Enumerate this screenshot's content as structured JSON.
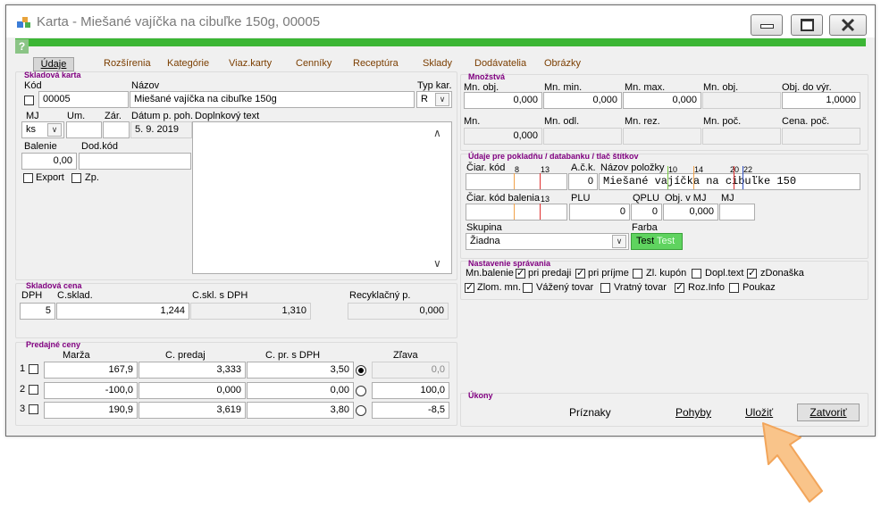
{
  "window": {
    "title": "Karta - Miešané vajíčka na cibuľke 150g, 00005"
  },
  "help": "?",
  "tabs": [
    "Údaje",
    "Rozšírenia",
    "Kategórie",
    "Viaz.karty",
    "Cenníky",
    "Receptúra",
    "Sklady",
    "Dodávatelia",
    "Obrázky"
  ],
  "skladova_karta": {
    "title": "Skladová karta",
    "kod_label": "Kód",
    "kod": "00005",
    "nazov_label": "Názov",
    "nazov": "Miešané vajíčka na cibuľke 150g",
    "typ_label": "Typ kar.",
    "typ": "R",
    "mj_label": "MJ",
    "mj": "ks",
    "um_label": "Um.",
    "zar_label": "Zár.",
    "datum_label": "Dátum p. poh.",
    "datum": "5. 9. 2019",
    "doplnkovy_label": "Doplnkový text",
    "balenie_label": "Balenie",
    "balenie": "0,00",
    "dodkod_label": "Dod.kód",
    "export_label": "Export",
    "zp_label": "Zp."
  },
  "skladova_cena": {
    "title": "Skladová cena",
    "dph_label": "DPH",
    "dph": "5",
    "csklad_label": "C.sklad.",
    "csklad": "1,244",
    "csklsdph_label": "C.skl. s DPH",
    "csklsdph": "1,310",
    "recykl_label": "Recyklačný p.",
    "recykl": "0,000"
  },
  "predajne_ceny": {
    "title": "Predajné ceny",
    "headers": {
      "marza": "Marža",
      "cpredaj": "C. predaj",
      "cprsdph": "C. pr. s DPH",
      "zlava": "Zľava"
    },
    "rows": [
      {
        "num": "1",
        "marza": "167,9",
        "cpredaj": "3,333",
        "cprsdph": "3,50",
        "zlava": "0,0",
        "selected": true
      },
      {
        "num": "2",
        "marza": "-100,0",
        "cpredaj": "0,000",
        "cprsdph": "0,00",
        "zlava": "100,0",
        "selected": false
      },
      {
        "num": "3",
        "marza": "190,9",
        "cpredaj": "3,619",
        "cprsdph": "3,80",
        "zlava": "-8,5",
        "selected": false
      }
    ]
  },
  "mnozstva": {
    "title": "Množstvá",
    "row1": [
      {
        "label": "Mn. obj.",
        "value": "0,000"
      },
      {
        "label": "Mn. min.",
        "value": "0,000"
      },
      {
        "label": "Mn. max.",
        "value": "0,000"
      },
      {
        "label": "Mn. obj.",
        "value": ""
      },
      {
        "label": "Obj. do výr.",
        "value": "1,0000"
      }
    ],
    "row2": [
      {
        "label": "Mn.",
        "value": "0,000"
      },
      {
        "label": "Mn. odl.",
        "value": ""
      },
      {
        "label": "Mn. rez.",
        "value": ""
      },
      {
        "label": "Mn. poč.",
        "value": ""
      },
      {
        "label": "Cena. poč.",
        "value": ""
      }
    ]
  },
  "pokladna": {
    "title": "Údaje pre pokladňu / databanku / tlač štítkov",
    "ciar_kod_label": "Čiar. kód",
    "ack_label": "A.č.k.",
    "ack": "0",
    "nazov_polozky_label": "Názov položky",
    "nazov_polozky": "Miešané vajíčka na cibuľke 150",
    "ticks": [
      "8",
      "13",
      "10",
      "14",
      "20",
      "22"
    ],
    "ciar_kod_balenia_label": "Čiar. kód balenia",
    "tick13b": "13",
    "plu_label": "PLU",
    "plu": "0",
    "qplu_label": "QPLU",
    "qplu": "0",
    "objvmj_label": "Obj. v MJ",
    "objvmj": "0,000",
    "mj_label": "MJ",
    "skupina_label": "Skupina",
    "skupina": "Žiadna",
    "farba_label": "Farba",
    "farba_test": "Test",
    "farba_test2": "Test",
    "farba_color": "#5fd35f"
  },
  "nastavenie": {
    "title": "Nastavenie správania",
    "row1": [
      {
        "label": "Mn.balenie",
        "checked": null
      },
      {
        "label": "pri predaji",
        "checked": true
      },
      {
        "label": "pri príjme",
        "checked": true
      },
      {
        "label": "Zl. kupón",
        "checked": false
      },
      {
        "label": "Dopl.text",
        "checked": false
      },
      {
        "label": "zDonaška",
        "checked": true
      }
    ],
    "row2": [
      {
        "label": "Zlom. mn.",
        "checked": true
      },
      {
        "label": "Vážený tovar",
        "checked": false
      },
      {
        "label": "Vratný tovar",
        "checked": false
      },
      {
        "label": "Roz.Info",
        "checked": true
      },
      {
        "label": "Poukaz",
        "checked": false
      }
    ]
  },
  "ukony": {
    "title": "Úkony",
    "priznaky": "Príznaky",
    "pohyby": "Pohyby",
    "ulozit": "Uložiť",
    "zatvorit": "Zatvoriť"
  },
  "colors": {
    "accent_green": "#3cb635",
    "group_title": "#800080",
    "tab_text": "#7b3e00",
    "arrow": "#f9c48a"
  }
}
